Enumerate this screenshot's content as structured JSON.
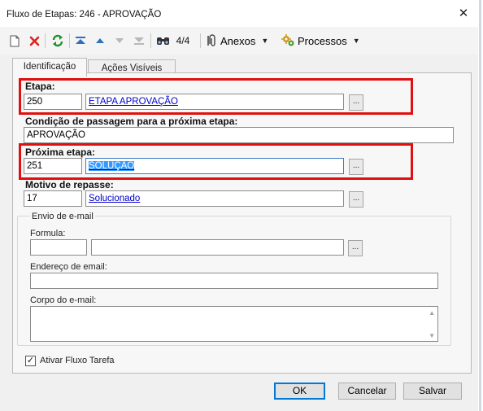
{
  "window": {
    "title": "Fluxo de Etapas: 246 - APROVAÇÃO",
    "close_glyph": "✕"
  },
  "toolbar": {
    "record_counter": "4/4",
    "anexos_label": "Anexos",
    "processos_label": "Processos",
    "icons": [
      "new-document-icon",
      "delete-icon",
      "refresh-icon",
      "first-record-icon",
      "previous-record-icon",
      "next-record-icon",
      "last-record-icon",
      "search-icon",
      "attachment-icon",
      "processes-gear-icon"
    ]
  },
  "tabs": [
    {
      "label": "Identificação",
      "active": true
    },
    {
      "label": "Ações Visíveis",
      "active": false
    }
  ],
  "form": {
    "etapa": {
      "label": "Etapa:",
      "code": "250",
      "name": "ETAPA APROVAÇÃO",
      "button": "..."
    },
    "condicao": {
      "label": "Condição de passagem para a próxima etapa:",
      "value": "APROVAÇÃO"
    },
    "proxima_etapa": {
      "label": "Próxima etapa:",
      "code": "251",
      "name": "SOLUÇÃO",
      "button": "..."
    },
    "motivo": {
      "label": "Motivo de repasse:",
      "code": "17",
      "name": "Solucionado",
      "button": "..."
    },
    "email_group": {
      "title": "Envio de e-mail",
      "formula_label": "Formula:",
      "formula_code": "",
      "formula_name": "",
      "formula_button": "...",
      "endereco_label": "Endereço de email:",
      "endereco_value": "",
      "corpo_label": "Corpo do e-mail:",
      "corpo_value": ""
    },
    "ativar": {
      "label": "Ativar Fluxo Tarefa",
      "checked": true,
      "check_glyph": "✓"
    }
  },
  "buttons": {
    "ok": "OK",
    "cancel": "Cancelar",
    "save": "Salvar"
  },
  "colors": {
    "highlight_border": "#e01010",
    "link": "#0000cc",
    "selection": "#3399ff"
  }
}
